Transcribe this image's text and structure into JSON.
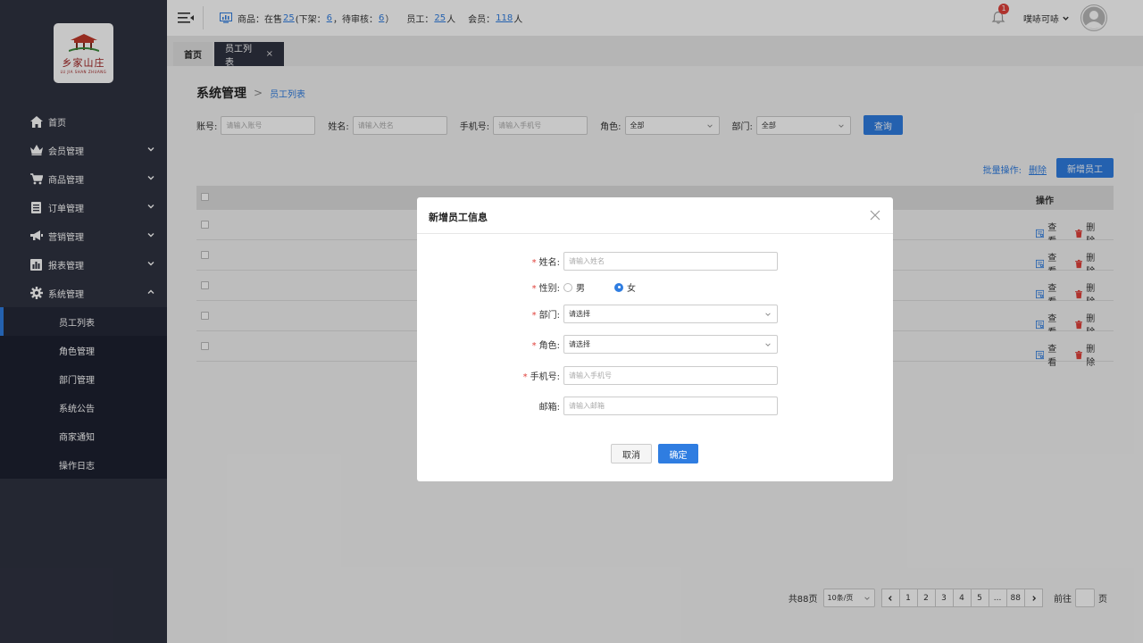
{
  "brand": {
    "logo_text": "乡家山庄",
    "logo_sub": "LU JIA SHAN ZHUANG"
  },
  "sidebar": {
    "items": [
      {
        "label": "首页",
        "icon": "home-icon"
      },
      {
        "label": "会员管理",
        "icon": "crown-icon"
      },
      {
        "label": "商品管理",
        "icon": "cart-icon"
      },
      {
        "label": "订单管理",
        "icon": "order-icon"
      },
      {
        "label": "营销管理",
        "icon": "megaphone-icon"
      },
      {
        "label": "报表管理",
        "icon": "bar-chart-icon"
      },
      {
        "label": "系统管理",
        "icon": "gear-icon"
      }
    ],
    "sub_items": [
      "员工列表",
      "角色管理",
      "部门管理",
      "系统公告",
      "商家通知",
      "操作日志"
    ]
  },
  "topbar": {
    "goods_label": "商品：在售",
    "on_sale": "25",
    "offshelf_label": "(下架：",
    "offshelf": "6",
    "pending_label": "，待审核：",
    "pending": "6",
    "pending_close": "）",
    "staff_label": "员工：",
    "staff": "25",
    "staff_unit": "人",
    "member_label": "会员：",
    "member": "118",
    "member_unit": "人",
    "notify_count": "1",
    "user_name": "噗哧可哧"
  },
  "tabs": {
    "home": "首页",
    "active": "员工列表",
    "close": "×"
  },
  "breadcrumb": {
    "parent": "系统管理",
    "sep": ">",
    "current": "员工列表"
  },
  "filters": {
    "account_label": "账号:",
    "account_ph": "请输入账号",
    "name_label": "姓名:",
    "name_ph": "请输入姓名",
    "phone_label": "手机号:",
    "phone_ph": "请输入手机号",
    "role_label": "角色:",
    "role_value": "全部",
    "dept_label": "部门:",
    "dept_value": "全部",
    "query": "查询"
  },
  "toolbar": {
    "batch_label": "批量操作:",
    "delete": "删除",
    "add": "新增员工"
  },
  "table": {
    "action_header": "操作",
    "view": "查看",
    "delete": "删除",
    "rows": 5
  },
  "pagination": {
    "total": "共88页",
    "size": "10条/页",
    "pages": [
      "1",
      "2",
      "3",
      "4",
      "5",
      "...",
      "88"
    ],
    "goto": "前往",
    "page_unit": "页"
  },
  "modal": {
    "title": "新增员工信息",
    "required_mark": "*",
    "name_label": "姓名:",
    "name_ph": "请输入姓名",
    "gender_label": "性别:",
    "male": "男",
    "female": "女",
    "gender_selected": "女",
    "dept_label": "部门:",
    "dept_ph": "请选择",
    "role_label": "角色:",
    "role_ph": "请选择",
    "phone_label": "手机号:",
    "phone_ph": "请输入手机号",
    "email_label": "邮箱:",
    "email_ph": "请输入邮箱",
    "cancel": "取消",
    "confirm": "确定"
  },
  "colors": {
    "primary": "#2f7de1",
    "sidebar_bg": "#2f3241",
    "danger": "#e0403a"
  }
}
